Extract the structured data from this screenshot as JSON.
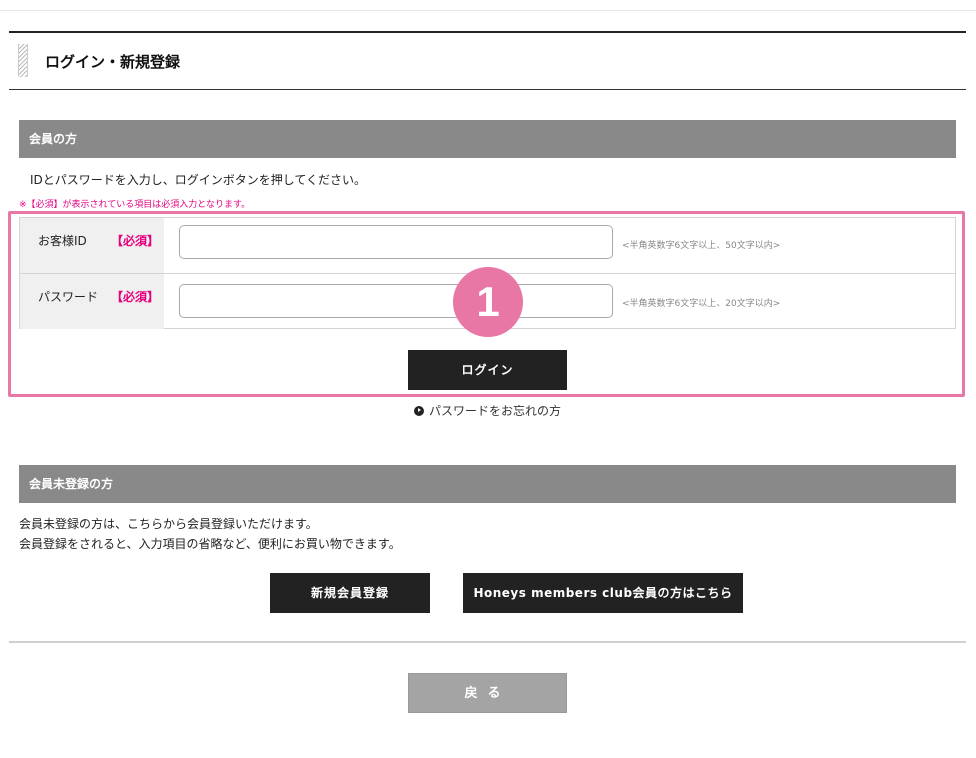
{
  "page": {
    "title": "ログイン・新規登録"
  },
  "member": {
    "header": "会員の方",
    "instruction": "IDとパスワードを入力し、ログインボタンを押してください。",
    "required_note": "※【必須】が表示されている項目は必須入力となります。",
    "fields": [
      {
        "label": "お客様ID",
        "required": "【必須】",
        "value": "",
        "hint": "<半角英数字6文字以上、50文字以内>"
      },
      {
        "label": "パスワード",
        "required": "【必須】",
        "value": "",
        "hint": "<半角英数字6文字以上、20文字以内>"
      }
    ],
    "login_button": "ログイン",
    "forgot_link": "パスワードをお忘れの方",
    "step_badge": "1"
  },
  "nonmember": {
    "header": "会員未登録の方",
    "line1": "会員未登録の方は、こちらから会員登録いただけます。",
    "line2": "会員登録をされると、入力項目の省略など、便利にお買い物できます。",
    "register_button": "新規会員登録",
    "honeys_button": "Honeys members club会員の方はこちら"
  },
  "back_button": "戻る",
  "colors": {
    "highlight": "#e877a6",
    "required": "#e4007f",
    "section_header": "#898989",
    "button_dark": "#222222",
    "button_back": "#a4a4a4"
  }
}
